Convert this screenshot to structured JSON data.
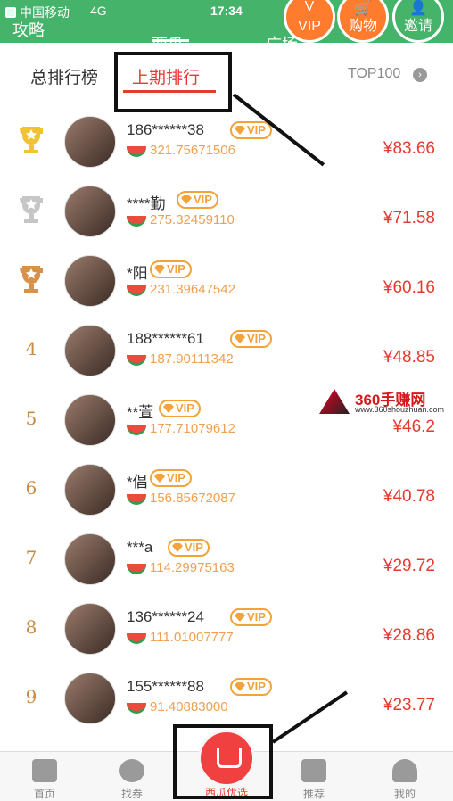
{
  "status_bar": {
    "carrier": "中国移动",
    "network": "4G",
    "time": "17:34"
  },
  "top_nav": {
    "left_label": "攻略",
    "tabs": [
      "西瓜",
      "广场"
    ],
    "buttons": [
      {
        "label": "VIP",
        "glyph": "V"
      },
      {
        "label": "购物",
        "glyph": "🛒"
      },
      {
        "label": "邀请",
        "glyph": "👤"
      }
    ]
  },
  "ranking_tabs": {
    "total": "总排行榜",
    "last": "上期排行",
    "top100": "TOP100"
  },
  "vip_badge": "VIP",
  "rows": [
    {
      "rank": "1",
      "name": "186******38",
      "score": "321.75671506",
      "amount": "¥83.66",
      "trophy": "gold"
    },
    {
      "rank": "2",
      "name": "****勤",
      "score": "275.32459110",
      "amount": "¥71.58",
      "trophy": "silver"
    },
    {
      "rank": "3",
      "name": "*阳",
      "score": "231.39647542",
      "amount": "¥60.16",
      "trophy": "bronze"
    },
    {
      "rank": "4",
      "name": "188******61",
      "score": "187.90111342",
      "amount": "¥48.85"
    },
    {
      "rank": "5",
      "name": "**萱",
      "score": "177.71079612",
      "amount": "¥46.2"
    },
    {
      "rank": "6",
      "name": "*倡",
      "score": "156.85672087",
      "amount": "¥40.78"
    },
    {
      "rank": "7",
      "name": "***a",
      "score": "114.29975163",
      "amount": "¥29.72"
    },
    {
      "rank": "8",
      "name": "136******24",
      "score": "111.01007777",
      "amount": "¥28.86"
    },
    {
      "rank": "9",
      "name": "155******88",
      "score": "91.40883000",
      "amount": "¥23.77"
    }
  ],
  "watermark": {
    "title": "360手赚网",
    "url": "www.360shouzhuan.com"
  },
  "bottom_nav": [
    {
      "label": "首页"
    },
    {
      "label": "找券"
    },
    {
      "label": "西瓜优选"
    },
    {
      "label": "推荐"
    },
    {
      "label": "我的"
    }
  ],
  "colors": {
    "accent": "#e8392f",
    "topbar": "#46b36a",
    "vip": "#f2a33a",
    "score": "#f0a050"
  }
}
